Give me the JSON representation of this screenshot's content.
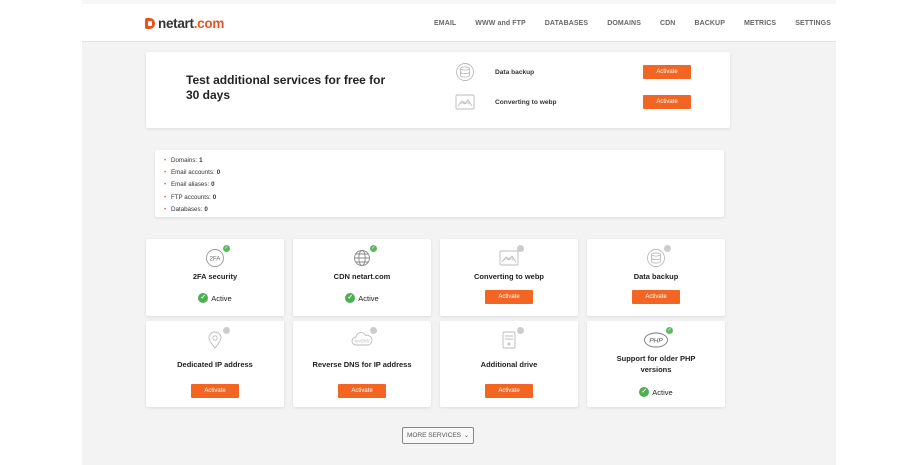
{
  "header": {
    "logo": {
      "prefix": "netart",
      "suffix": ".com"
    },
    "nav": [
      "EMAIL",
      "WWW and FTP",
      "DATABASES",
      "DOMAINS",
      "CDN",
      "BACKUP",
      "METRICS",
      "SETTINGS"
    ]
  },
  "promo": {
    "title": "Test additional services for free for 30 days",
    "items": [
      {
        "label": "Data backup",
        "button": "Activate",
        "icon": "database-backup-icon"
      },
      {
        "label": "Converting to webp",
        "button": "Activate",
        "icon": "webp-image-icon"
      }
    ]
  },
  "stats": [
    {
      "label": "Domains:",
      "value": "1"
    },
    {
      "label": "Email accounts:",
      "value": "0"
    },
    {
      "label": "Email aliases:",
      "value": "0"
    },
    {
      "label": "FTP accounts:",
      "value": "0"
    },
    {
      "label": "Databases:",
      "value": "0"
    }
  ],
  "services": [
    {
      "title": "2FA security",
      "status": "Active",
      "icon": "2fa-icon",
      "icon_text": "2FA"
    },
    {
      "title": "CDN netart.com",
      "status": "Active",
      "icon": "globe-icon"
    },
    {
      "title": "Converting to webp",
      "button": "Activate",
      "icon": "webp-image-icon",
      "icon_text": "webp"
    },
    {
      "title": "Data backup",
      "button": "Activate",
      "icon": "database-backup-icon"
    },
    {
      "title": "Dedicated IP address",
      "button": "Activate",
      "icon": "location-pin-icon"
    },
    {
      "title": "Reverse DNS for IP address",
      "button": "Activate",
      "icon": "rdns-cloud-icon",
      "icon_text": "revDNS"
    },
    {
      "title": "Additional drive",
      "button": "Activate",
      "icon": "drive-icon"
    },
    {
      "title": "Support for older PHP versions",
      "status": "Active",
      "icon": "php-icon",
      "icon_text": "PHP"
    }
  ],
  "more_button": "MORE SERVICES",
  "colors": {
    "accent": "#f26522",
    "active": "#4caf50",
    "background": "#f3f3f3"
  }
}
